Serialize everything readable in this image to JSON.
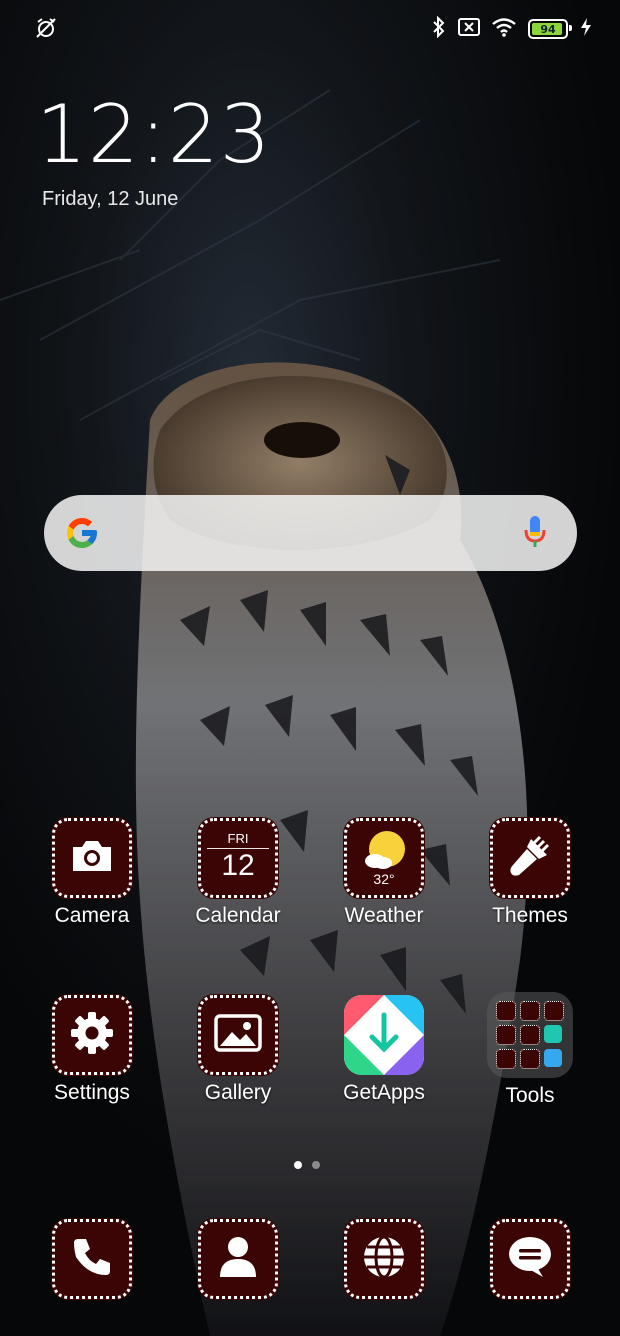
{
  "status_bar": {
    "left_icon": "alarm-off-icon",
    "right_icons": [
      "bluetooth-icon",
      "no-sim-icon",
      "wifi-icon",
      "battery-icon",
      "charging-icon"
    ],
    "battery_level": "94",
    "battery_color": "#8cd63b"
  },
  "lockscreen": {
    "time": "12:23",
    "date": "Friday, 12 June"
  },
  "search_bar": {
    "left_icon": "google-g-icon",
    "right_icon": "microphone-icon"
  },
  "apps_row1": [
    {
      "label": "Camera",
      "icon": "camera-icon"
    },
    {
      "label": "Calendar",
      "icon": "calendar-icon",
      "day": "FRI",
      "date": "12"
    },
    {
      "label": "Weather",
      "icon": "weather-sun-icon",
      "temp": "32°"
    },
    {
      "label": "Themes",
      "icon": "paintbrush-icon"
    }
  ],
  "apps_row2": [
    {
      "label": "Settings",
      "icon": "gear-icon"
    },
    {
      "label": "Gallery",
      "icon": "image-icon"
    },
    {
      "label": "GetApps",
      "icon": "getapps-icon"
    },
    {
      "label": "Tools",
      "icon": "folder-icon"
    }
  ],
  "dock": [
    {
      "icon": "phone-icon"
    },
    {
      "icon": "contacts-icon"
    },
    {
      "icon": "browser-globe-icon"
    },
    {
      "icon": "messages-icon"
    }
  ],
  "page_indicator": {
    "pages": 2,
    "current": 1
  },
  "colors": {
    "tile_bg": "#3b0505",
    "tile_border": "#ffffff"
  }
}
